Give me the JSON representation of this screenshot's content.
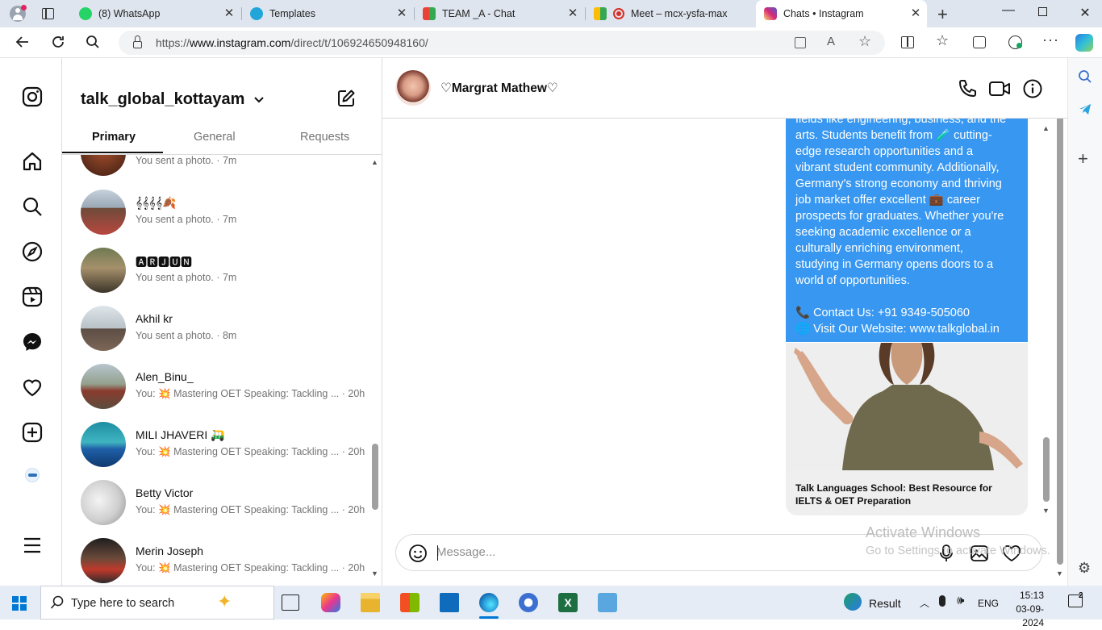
{
  "browser": {
    "tabs": [
      {
        "label": "(8) WhatsApp",
        "color": "#25d366"
      },
      {
        "label": "Templates",
        "color": "#6c5ce7"
      },
      {
        "label": "TEAM _A - Chat",
        "color": "#e53935"
      },
      {
        "label": "Meet – mcx-ysfa-max",
        "color": "#d93025"
      },
      {
        "label": "Chats • Instagram",
        "color": "#d6249f"
      }
    ],
    "url_prefix": "https://",
    "url_domain": "www.instagram.com",
    "url_path": "/direct/t/106924650948160/"
  },
  "sidebar": {
    "account_name": "talk_global_kottayam",
    "tabs": [
      "Primary",
      "General",
      "Requests"
    ],
    "conversations": [
      {
        "name": "",
        "preview": "You sent a photo.",
        "time": "· 7m"
      },
      {
        "name": "𝄞𝄞𝄞𝄞🍂",
        "preview": "You sent a photo.",
        "time": "· 7m"
      },
      {
        "name": "🅰🆁🅹🆄🅽",
        "preview": "You sent a photo.",
        "time": "· 7m"
      },
      {
        "name": "Akhil kr",
        "preview": "You sent a photo.",
        "time": "· 8m"
      },
      {
        "name": "Alen_Binu_",
        "preview": "You: 💥 Mastering OET Speaking: Tackling ...",
        "time": "· 20h"
      },
      {
        "name": "MILI JHAVERI 🛺",
        "preview": "You: 💥 Mastering OET Speaking: Tackling ...",
        "time": "· 20h"
      },
      {
        "name": "Betty Victor",
        "preview": "You: 💥 Mastering OET Speaking: Tackling ...",
        "time": "· 20h"
      },
      {
        "name": "Merin Joseph",
        "preview": "You: 💥 Mastering OET Speaking: Tackling ...",
        "time": "· 20h"
      }
    ]
  },
  "chat": {
    "contact_name": "♡Margrat Mathew♡",
    "message_lines": [
      "fields like engineering, business, and the",
      "arts. Students benefit from 🧪 cutting-",
      "edge research opportunities and a",
      "vibrant student community. Additionally,",
      "Germany's strong economy and thriving",
      "job market offer excellent 💼 career",
      "prospects for graduates. Whether you're",
      "seeking academic excellence or a",
      "culturally enriching environment,",
      "studying in Germany opens doors to a",
      "world of opportunities."
    ],
    "contact_line": "📞 Contact Us: +91 9349-505060",
    "website_label": "🌐 Visit Our Website: ",
    "website_link": "www.talkglobal.in",
    "card_title": "Talk Languages School: Best Resource for IELTS & OET Preparation",
    "message_placeholder": "Message..."
  },
  "watermark": {
    "line1": "Activate Windows",
    "line2": "Go to Settings to activate Windows."
  },
  "taskbar": {
    "search_placeholder": "Type here to search",
    "weather_label": "Result",
    "language": "ENG",
    "time": "15:13",
    "date": "03-09-2024",
    "notification_count": "2"
  },
  "colors": {
    "bubble": "#3897f0",
    "link": "#ffffff",
    "tabbar": "#dfe5ee"
  }
}
